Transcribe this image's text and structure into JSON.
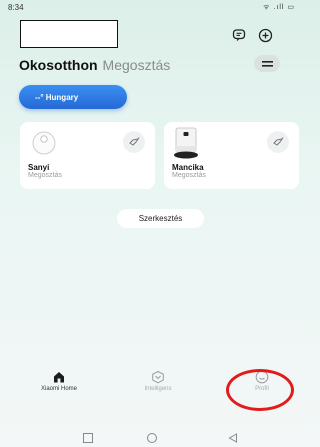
{
  "status_bar": {
    "time": "8:34",
    "icons": "ᯤ .ıll ▭"
  },
  "header": {
    "message_icon": "message-icon",
    "add_icon": "plus-circle-icon",
    "menu_icon": "hamburger-icon"
  },
  "tabs": {
    "active": "Okosotthon",
    "inactive": "Megosztás"
  },
  "region": {
    "label": "--° Hungary"
  },
  "devices": [
    {
      "name": "Sanyi",
      "subtitle": "Megosztás",
      "icon": "robot-vacuum-icon"
    },
    {
      "name": "Mancika",
      "subtitle": "Megosztás",
      "icon": "vacuum-station-icon"
    }
  ],
  "edit_label": "Szerkesztés",
  "bottom_nav": [
    {
      "label": "Xiaomi Home",
      "icon": "home-icon",
      "active": true
    },
    {
      "label": "Intelligens",
      "icon": "smart-cube-icon",
      "active": false
    },
    {
      "label": "Profil",
      "icon": "profile-icon",
      "active": false
    }
  ],
  "colors": {
    "accent_blue": "#2569d6",
    "highlight_red": "#e21b1b"
  }
}
